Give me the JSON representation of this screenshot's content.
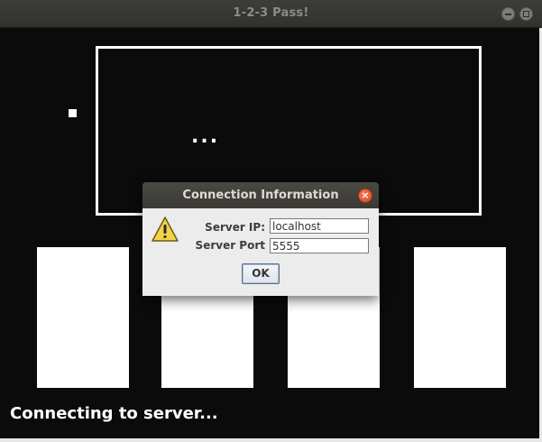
{
  "window": {
    "title": "1-2-3 Pass!",
    "minimize_icon": "minimize-icon",
    "maximize_icon": "maximize-icon"
  },
  "game": {
    "ellipsis": "...",
    "status": "Connecting to server...",
    "cards": [
      "card-1",
      "card-2",
      "card-3",
      "card-4"
    ],
    "colors": {
      "background": "#0b0b0b",
      "foreground": "#ffffff"
    }
  },
  "dialog": {
    "title": "Connection Information",
    "icon": "warning-icon",
    "close_icon": "close-icon",
    "server_ip_label": "Server IP:",
    "server_ip_value": "localhost",
    "server_port_label": "Server Port",
    "server_port_value": "5555",
    "ok_label": "OK"
  }
}
